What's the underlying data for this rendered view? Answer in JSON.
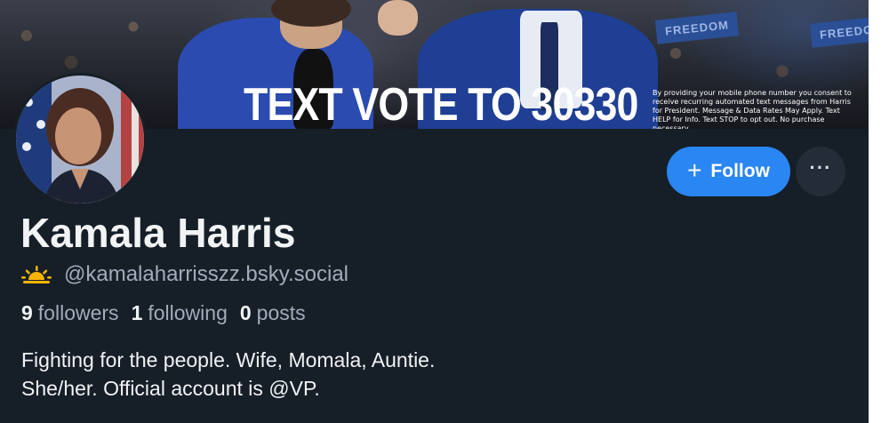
{
  "banner": {
    "headline": "TEXT VOTE TO 30330",
    "disclaimer": "By providing your mobile phone number you consent to receive recurring automated text messages from Harris for President. Message & Data Rates May Apply. Text HELP for Info. Text STOP to opt out. No purchase necessary.",
    "sign_text": "FREEDOM"
  },
  "profile": {
    "display_name": "Kamala Harris",
    "handle": "@kamalaharrisszz.bsky.social",
    "handle_icon": "sun-icon",
    "stats": {
      "followers_count": "9",
      "followers_label": "followers",
      "following_count": "1",
      "following_label": "following",
      "posts_count": "0",
      "posts_label": "posts"
    },
    "bio": {
      "line1": "Fighting for the people. Wife, Momala, Auntie.",
      "line2": "She/her. Official account is @VP."
    }
  },
  "actions": {
    "follow_label": "Follow",
    "follow_icon": "plus-icon",
    "more_label": "···",
    "more_icon": "more-options-icon"
  },
  "colors": {
    "background": "#161e27",
    "accent": "#2a86f2",
    "text_primary": "#f1f3f5",
    "text_secondary": "#a1acba",
    "sun": "#f5b400"
  }
}
